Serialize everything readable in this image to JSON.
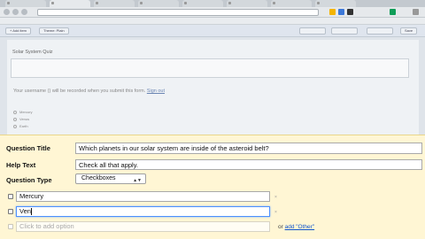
{
  "browser": {
    "tabs": [
      "",
      "",
      "",
      "",
      "",
      "",
      "",
      ""
    ],
    "url": "",
    "bookmarks": [
      "",
      "",
      "",
      "",
      "",
      "",
      ""
    ],
    "ext_colors": [
      "#f4b400",
      "#3c78d8",
      "#333333",
      "#0f9d58"
    ]
  },
  "toolbar": {
    "buttons_left": [
      "+ Add item",
      "Theme: Plain"
    ],
    "buttons_right": [
      "",
      "",
      "",
      "Save"
    ]
  },
  "form_preview": {
    "title": "Solar System Quiz",
    "description": "",
    "notice_pre": "Your username (",
    "notice_user": "",
    "notice_mid": ") will be recorded when you submit this form.",
    "notice_link": "Sign out",
    "prev_question": "",
    "prev_options": [
      "Mercury",
      "Venus",
      "Earth"
    ]
  },
  "editor": {
    "question_title_label": "Question Title",
    "question_title_value": "Which planets in our solar system are inside of the asteroid belt?",
    "help_text_label": "Help Text",
    "help_text_value": "Check all that apply.",
    "question_type_label": "Question Type",
    "question_type_value": "Checkboxes",
    "options": [
      "Mercury",
      "Ven"
    ],
    "add_option_placeholder": "Click to add option",
    "or_text": "or",
    "add_other_link": "add \"Other\"",
    "remove_icon": "×"
  }
}
